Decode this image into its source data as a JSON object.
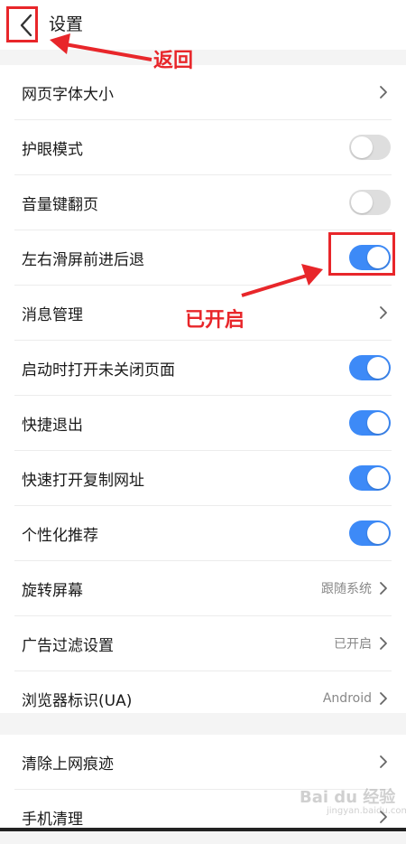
{
  "header": {
    "title": "设置"
  },
  "settings": [
    {
      "label": "网页字体大小",
      "control": "chevron",
      "value": ""
    },
    {
      "label": "护眼模式",
      "control": "toggle",
      "on": false
    },
    {
      "label": "音量键翻页",
      "control": "toggle",
      "on": false
    },
    {
      "label": "左右滑屏前进后退",
      "control": "toggle",
      "on": true
    },
    {
      "label": "消息管理",
      "control": "chevron",
      "value": ""
    },
    {
      "label": "启动时打开未关闭页面",
      "control": "toggle",
      "on": true
    },
    {
      "label": "快捷退出",
      "control": "toggle",
      "on": true
    },
    {
      "label": "快速打开复制网址",
      "control": "toggle",
      "on": true
    },
    {
      "label": "个性化推荐",
      "control": "toggle",
      "on": true
    },
    {
      "label": "旋转屏幕",
      "control": "chevron",
      "value": "跟随系统"
    },
    {
      "label": "广告过滤设置",
      "control": "chevron",
      "value": "已开启"
    },
    {
      "label": "浏览器标识(UA)",
      "control": "chevron",
      "value": "Android"
    }
  ],
  "settings2": [
    {
      "label": "清除上网痕迹",
      "control": "chevron",
      "value": ""
    },
    {
      "label": "手机清理",
      "control": "chevron",
      "value": ""
    }
  ],
  "annotations": {
    "back_label": "返回",
    "enabled_label": "已开启"
  },
  "watermark": {
    "main": "Bai du 经验",
    "sub": "jingyan.baidu.com"
  },
  "colors": {
    "accent": "#3d8af7",
    "annotation": "#e8262a",
    "toggle_off": "#dedede"
  },
  "icons": {
    "back": "chevron-left-icon",
    "chevron": "chevron-right-icon"
  }
}
